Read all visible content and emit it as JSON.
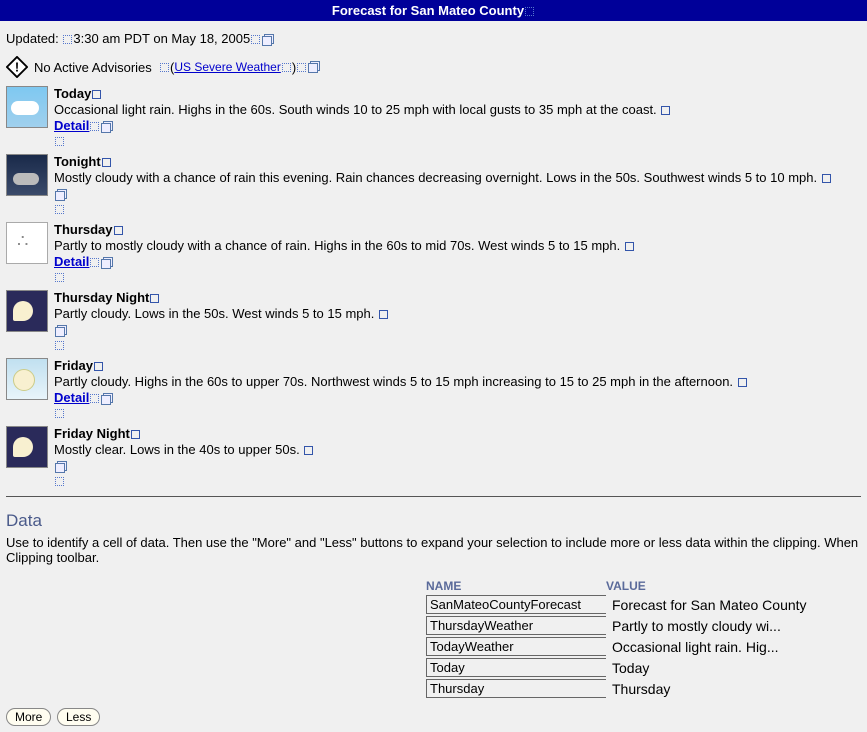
{
  "header": {
    "title": "Forecast for San Mateo County"
  },
  "updated": {
    "label": "Updated:",
    "time": "3:30 am PDT on May 18, 2005"
  },
  "advisory": {
    "text": "No Active Advisories",
    "us_link": "US Severe Weather"
  },
  "forecasts": [
    {
      "label": "Today",
      "desc": "Occasional light rain. Highs in the 60s. South winds 10 to 25 mph with local gusts to 35 mph at the coast.",
      "detail": "Detail",
      "icon": "ic-today"
    },
    {
      "label": "Tonight",
      "desc": "Mostly cloudy with a chance of rain this evening. Rain chances decreasing overnight. Lows in the 50s. Southwest winds 5 to 10 mph.",
      "detail": "",
      "icon": "ic-tonight"
    },
    {
      "label": "Thursday",
      "desc": "Partly to mostly cloudy with a chance of rain. Highs in the 60s to mid 70s. West winds 5 to 15 mph.",
      "detail": "Detail",
      "icon": "ic-thursday"
    },
    {
      "label": "Thursday Night",
      "desc": "Partly cloudy. Lows in the 50s. West winds 5 to 15 mph.",
      "detail": "",
      "icon": "ic-thunight"
    },
    {
      "label": "Friday",
      "desc": "Partly cloudy. Highs in the 60s to upper 70s. Northwest winds 5 to 15 mph increasing to 15 to 25 mph in the afternoon.",
      "detail": "Detail",
      "icon": "ic-friday"
    },
    {
      "label": "Friday Night",
      "desc": "Mostly clear. Lows in the 40s to upper 50s.",
      "detail": "",
      "icon": "ic-frinight"
    }
  ],
  "data_section": {
    "heading": "Data",
    "instruction": "Use to identify a cell of data. Then use the \"More\" and \"Less\" buttons to expand your selection to include more or less data within the clipping. When Clipping toolbar.",
    "col_name": "NAME",
    "col_value": "VALUE",
    "rows": [
      {
        "name": "SanMateoCountyForecast",
        "value": "Forecast for San Mateo County"
      },
      {
        "name": "ThursdayWeather",
        "value": "Partly to mostly cloudy wi..."
      },
      {
        "name": "TodayWeather",
        "value": "Occasional light rain. Hig..."
      },
      {
        "name": "Today",
        "value": "Today"
      },
      {
        "name": "Thursday",
        "value": "Thursday"
      }
    ]
  },
  "buttons": {
    "more": "More",
    "less": "Less"
  }
}
